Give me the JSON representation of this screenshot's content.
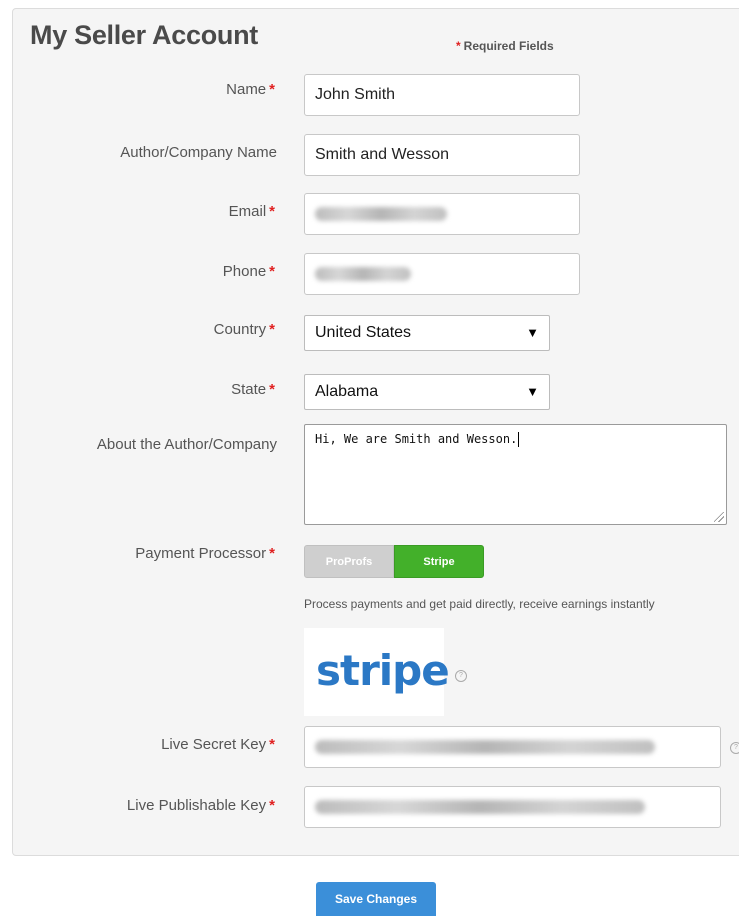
{
  "form": {
    "title": "My Seller Account",
    "required_note": "Required Fields",
    "required_star": "*",
    "fields": {
      "name": {
        "label": "Name",
        "value": "John Smith"
      },
      "author_company": {
        "label": "Author/Company Name",
        "value": "Smith and Wesson"
      },
      "email": {
        "label": "Email"
      },
      "phone": {
        "label": "Phone"
      },
      "country": {
        "label": "Country",
        "value": "United States"
      },
      "state": {
        "label": "State",
        "value": "Alabama"
      },
      "about": {
        "label": "About the Author/Company",
        "value": "Hi, We are Smith and Wesson."
      },
      "payment_processor": {
        "label": "Payment Processor",
        "options": [
          "ProProfs",
          "Stripe"
        ],
        "selected": "Stripe",
        "hint": "Process payments and get paid directly, receive earnings instantly"
      },
      "live_secret_key": {
        "label": "Live Secret Key"
      },
      "live_publishable_key": {
        "label": "Live Publishable Key"
      }
    },
    "stripe_logo_text": "stripe",
    "help_icon_glyph": "?",
    "dropdown_arrow": "▼",
    "save_label": "Save Changes"
  },
  "colors": {
    "panel_bg": "#f5f5f5",
    "required_star": "#e02020",
    "stripe_toggle": "#43b02a",
    "stripe_logo": "#2b78c5",
    "save_button": "#3b8fd9"
  }
}
